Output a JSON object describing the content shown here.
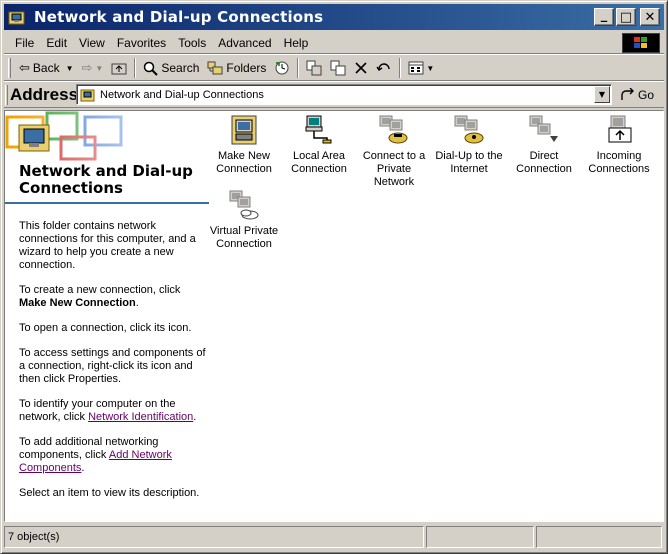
{
  "window": {
    "title": "Network and Dial-up Connections"
  },
  "title_buttons": {
    "minimize": "_",
    "maximize": "□",
    "close": "✕"
  },
  "menu": {
    "items": [
      "File",
      "Edit",
      "View",
      "Favorites",
      "Tools",
      "Advanced",
      "Help"
    ]
  },
  "toolbar": {
    "back_label": "Back",
    "search_label": "Search",
    "folders_label": "Folders"
  },
  "address": {
    "label": "Address",
    "value": "Network and Dial-up Connections",
    "go_label": "Go"
  },
  "left_pane": {
    "title": "Network and Dial-up Connections",
    "intro": "This folder contains network connections for this computer, and a wizard to help you create a new connection.",
    "create_text": "To create a new connection, click",
    "create_bold": "Make New Connection",
    "create_end": ".",
    "open_text": "To open a connection, click its icon.",
    "settings_text": "To access settings and components of a connection, right-click its icon and then click Properties.",
    "identify_text": "To identify your computer on the network, click",
    "identify_link": "Network Identification",
    "identify_end": ".",
    "add_text": "To add additional networking components, click",
    "add_link": "Add Network Components",
    "add_end": ".",
    "select_text": "Select an item to view its description."
  },
  "items": [
    {
      "label": "Make New Connection",
      "icon": "make-new-connection-icon"
    },
    {
      "label": "Local Area Connection",
      "icon": "local-area-connection-icon"
    },
    {
      "label": "Connect to a Private Network",
      "icon": "private-network-icon"
    },
    {
      "label": "Dial-Up to the Internet",
      "icon": "dialup-internet-icon"
    },
    {
      "label": "Direct Connection",
      "icon": "direct-connection-icon"
    },
    {
      "label": "Incoming Connections",
      "icon": "incoming-connections-icon"
    },
    {
      "label": "Virtual Private Connection",
      "icon": "vpn-connection-icon"
    }
  ],
  "status": {
    "objects": "7 object(s)"
  },
  "colors": {
    "title_start": "#0a246a",
    "title_end": "#3a6ea5",
    "link": "#660066"
  }
}
